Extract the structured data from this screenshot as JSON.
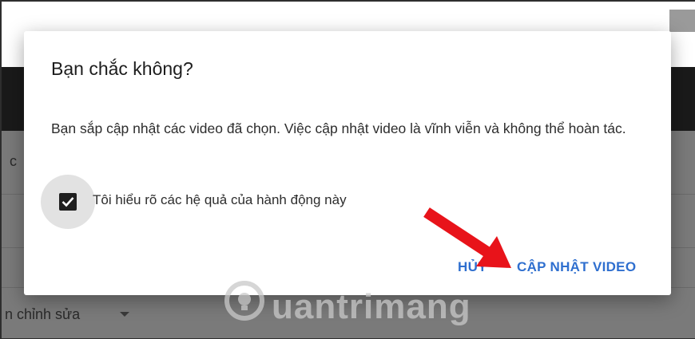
{
  "background": {
    "left_text_fragment": "c",
    "bottom_left_text": "n chỉnh sửa"
  },
  "dialog": {
    "title": "Bạn chắc không?",
    "body": "Bạn sắp cập nhật các video đã chọn. Việc cập nhật video là vĩnh viễn và không thể hoàn tác.",
    "checkbox_label": "Tôi hiểu rõ các hệ quả của hành động này",
    "checkbox_checked": true,
    "cancel_label": "HỦY",
    "confirm_label": "CẬP NHẬT VIDEO"
  },
  "colors": {
    "button_text": "#2f6fcf",
    "annotation_arrow": "#e8131a"
  },
  "watermark": {
    "text": "uantrimang"
  }
}
